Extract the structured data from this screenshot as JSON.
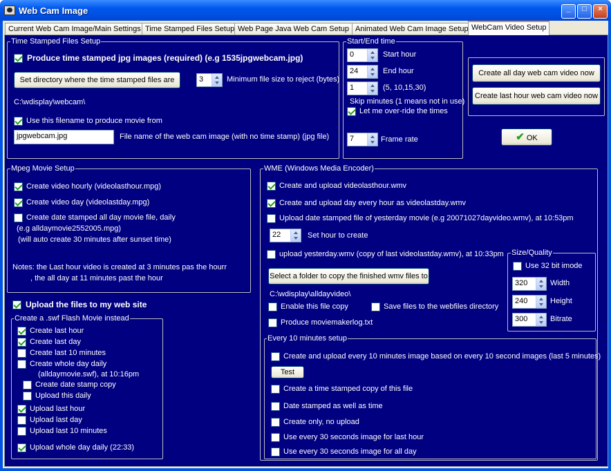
{
  "window": {
    "title": "Web Cam Image",
    "minimize": "_",
    "maximize": "□",
    "close": "×"
  },
  "tabs": [
    "Current Web Cam Image/Main Settings",
    "Time Stamped Files Setup",
    "Web Page Java Web Cam Setup",
    "Animated Web Cam Image Setup",
    "WebCam Video Setup"
  ],
  "tsf": {
    "legend": "Time Stamped Files Setup",
    "produce": "Produce time stamped jpg images (required) (e.g 1535jpgwebcam.jpg)",
    "set_dir_btn": "Set directory where the time stamped files are",
    "min_size_val": "3",
    "min_size_label": "Minimum file size to reject (bytes)",
    "dir_path": "C:\\wdisplay\\webcam\\",
    "use_filename": "Use this filename to produce movie from",
    "filename_val": "jpgwebcam.jpg",
    "filename_label": "File name of the web cam image (with no time stamp) (jpg file)"
  },
  "startend": {
    "legend": "Start/End time",
    "start_val": "0",
    "start_label": "Start hour",
    "end_val": "24",
    "end_label": "End hour",
    "skip_val": "1",
    "skip_label": "(5, 10,15,30)",
    "skip_note": "Skip minutes (1 means not in use)",
    "override": "Let me over-ride the times",
    "frame_val": "7",
    "frame_label": "Frame rate"
  },
  "create": {
    "all_day_btn": "Create all day web cam video now",
    "last_hour_btn": "Create last hour web cam video now"
  },
  "ok_btn": "OK",
  "mpeg": {
    "legend": "Mpeg Movie Setup",
    "hourly": "Create video hourly (videolasthour.mpg)",
    "day": "Create video day  (videolastday.mpg)",
    "date_stamped": "Create date stamped all day movie file, daily",
    "date_eg": "(e.g alldaymovie2552005.mpg)",
    "auto_note": "(will auto create 30 minutes after sunset time)",
    "notes1": "Notes: the Last hour video is created at 3 minutes pas the hourr",
    "notes2": ", the all day at 11 minutes past the hour"
  },
  "upload_files": "Upload the files to my web site",
  "swf": {
    "legend": "Create a .swf Flash Movie instead",
    "last_hour": "Create last hour",
    "last_day": "Create last day",
    "last_10": "Create last 10 minutes",
    "whole_day": "Create whole day daily",
    "whole_day_note": "(alldaymovie.swf), at 10:16pm",
    "date_stamp_copy": "Create date stamp copy",
    "upload_daily": "Upload this daily",
    "up_last_hour": "Upload last hour",
    "up_last_day": "Upload last day",
    "up_last_10": "Upload last 10 minutes",
    "up_whole_day": "Upload whole day daily (22:33)"
  },
  "wme": {
    "legend": "WME (Windows Media Encoder)",
    "lasthour": "Create and upload videolasthour.wmv",
    "lastday": "Create and upload day every hour as videolastday.wmv",
    "yesterday": "Upload date stamped file of yesterday movie (e.g 20071027dayvideo.wmv), at 10:53pm",
    "hour_val": "22",
    "hour_label": "Set hour to create",
    "upload_yesterday": "upload yesterday.wmv (copy of last videolastday.wmv), at 10:33pm",
    "folder_btn": "Select a folder to copy the finished wmv files to",
    "folder_path": "C:\\wdisplay\\alldayvideo\\",
    "enable_copy": "Enable this file copy",
    "save_webfiles": "Save files to the webfiles directory",
    "moviemaker_log": "Produce moviemakerlog.txt"
  },
  "size": {
    "legend": "Size/Quality",
    "use32": "Use 32 bit imode",
    "width_val": "320",
    "width_label": "Width",
    "height_val": "240",
    "height_label": "Height",
    "bitrate_val": "300",
    "bitrate_label": "Bitrate"
  },
  "every10": {
    "legend": "Every 10 minutes setup",
    "create_upload": "Create and upload every 10 minutes image based on every 10 second images (last 5 minutes)",
    "test_btn": "Test",
    "ts_copy": "Create a time stamped copy of this file",
    "date_time": "Date stamped as well as time",
    "create_only": "Create only, no upload",
    "every30_hour": "Use every 30 seconds image for last hour",
    "every30_day": "Use every 30 seconds image for all day"
  }
}
